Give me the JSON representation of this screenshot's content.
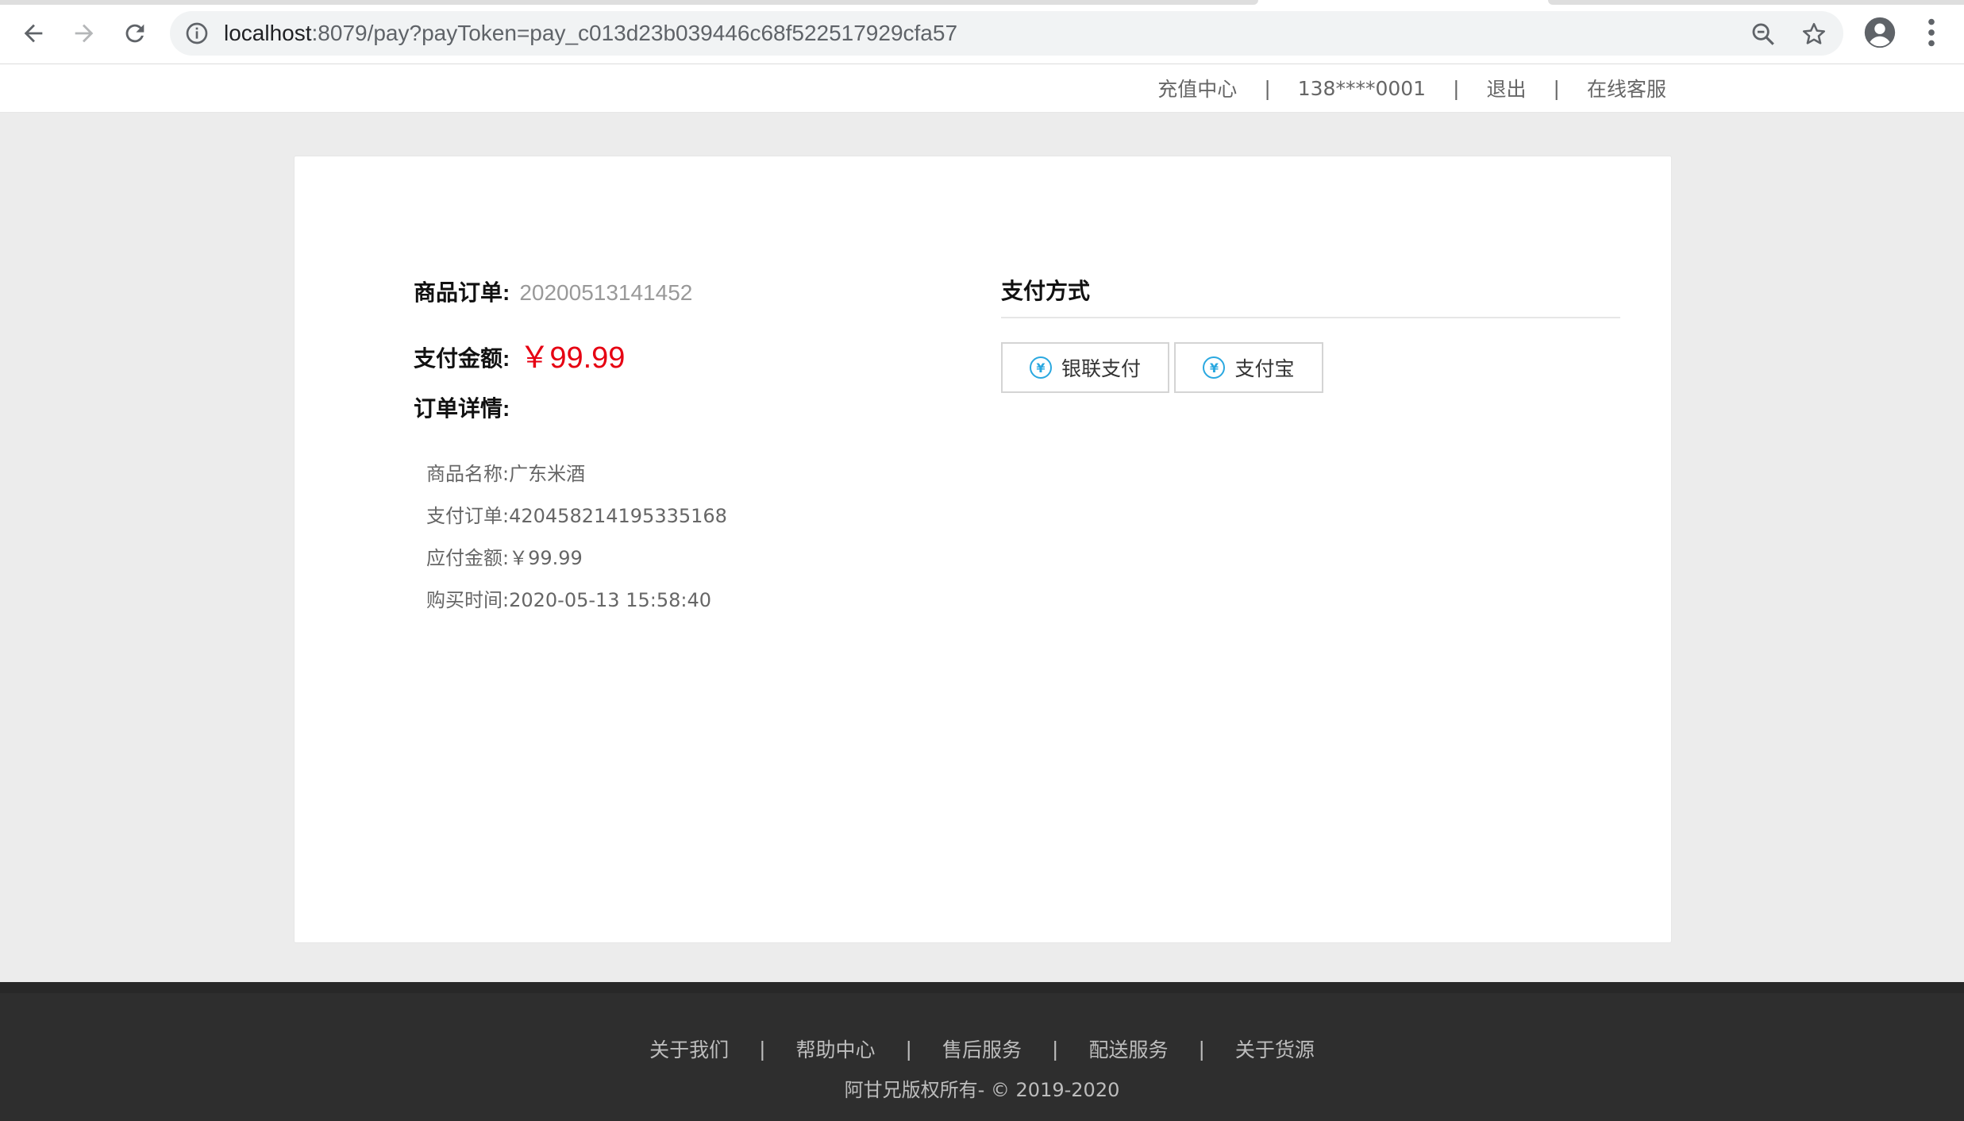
{
  "browser": {
    "url_host": "localhost",
    "url_rest": ":8079/pay?payToken=pay_c013d23b039446c68f522517929cfa57",
    "icons": [
      "back-arrow-icon",
      "forward-arrow-icon",
      "reload-icon",
      "info-icon",
      "zoom-out-icon",
      "star-icon",
      "account-icon",
      "more-vert-icon"
    ]
  },
  "topbar": {
    "recharge": "充值中心",
    "sep": "|",
    "phone": "138****0001",
    "logout": "退出",
    "service": "在线客服"
  },
  "order": {
    "order_label": "商品订单:",
    "order_no": "20200513141452",
    "amount_label": "支付金额:",
    "amount": "￥99.99",
    "detail_label": "订单详情:",
    "details": [
      {
        "k": "商品名称:",
        "v": "广东米酒"
      },
      {
        "k": "支付订单:",
        "v": "420458214195335168"
      },
      {
        "k": "应付金额:",
        "v": "￥99.99"
      },
      {
        "k": "购买时间:",
        "v": "2020-05-13 15:58:40"
      }
    ]
  },
  "payment": {
    "title": "支付方式",
    "unionpay": "银联支付",
    "alipay": "支付宝",
    "yen_glyph": "¥",
    "accent": "#2aa8e0"
  },
  "footer": {
    "links": [
      "关于我们",
      "帮助中心",
      "售后服务",
      "配送服务",
      "关于货源"
    ],
    "sep": "|",
    "copyright": "阿甘兄版权所有- © 2019-2020"
  },
  "colors": {
    "price_red": "#e60012",
    "footer_bg": "#2e2e2e",
    "page_bg": "#ececec"
  }
}
